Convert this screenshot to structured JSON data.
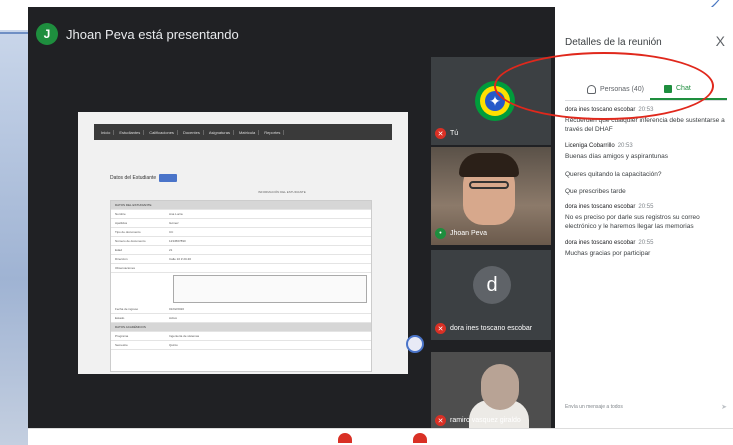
{
  "presenter": {
    "avatar_letter": "J",
    "text": "Jhoan Peva está presentando"
  },
  "shared_screen": {
    "nav": [
      "Inicio",
      "Estudiantes",
      "Calificaciones",
      "Docentes",
      "Asignaturas",
      "Matricula",
      "Reportes"
    ],
    "title": "Datos del Estudiante",
    "subtitle": "INFORMACIÓN DEL ESTUDIANTE",
    "rows": [
      {
        "a": "DATOS DEL ESTUDIANTE",
        "b": "",
        "head": true
      },
      {
        "a": "Nombre",
        "b": "Ana Lucía"
      },
      {
        "a": "Apellidos",
        "b": "Gómez"
      },
      {
        "a": "Tipo de documento",
        "b": "CC"
      },
      {
        "a": "Número de documento",
        "b": "1234567890"
      },
      {
        "a": "Edad",
        "b": "21"
      },
      {
        "a": "Dirección",
        "b": "Calle 10 # 20-30"
      },
      {
        "a": "Observaciones",
        "b": "",
        "box": true
      },
      {
        "a": "Fecha de ingreso",
        "b": "01/02/2020"
      },
      {
        "a": "Estado",
        "b": "Activo"
      },
      {
        "a": "DATOS ACADÉMICOS",
        "b": "",
        "head": true
      },
      {
        "a": "Programa",
        "b": "Ingeniería de sistemas"
      },
      {
        "a": "Semestre",
        "b": "Quinto"
      }
    ]
  },
  "tiles": [
    {
      "name": "Tú"
    },
    {
      "name": "Jhoan Peva"
    },
    {
      "name": "dora ines toscano escobar",
      "avatar_letter": "d"
    },
    {
      "name": "ramiro vasquez giraldo"
    }
  ],
  "panel": {
    "title": "Detalles de la reunión",
    "close": "X",
    "tab_people": "Personas (40)",
    "tab_chat": "Chat",
    "messages": [
      {
        "author": "dora ines toscano escobar",
        "time": "20:53",
        "text": "Recuerden que cualquier inferencia debe sustentarse a través del DHAF"
      },
      {
        "author": "Liceniga Cobarrillo",
        "time": "20:53",
        "text": "Buenas días amigos y aspirantunas",
        "extra": [
          "Queres quitando la capacitación?",
          "Que prescribes tarde"
        ]
      },
      {
        "author": "dora ines toscano escobar",
        "time": "20:55",
        "text": "No es preciso por darle sus registros su correo electrónico y le haremos llegar las memorias"
      },
      {
        "author": "dora ines toscano escobar",
        "time": "20:55",
        "text": "Muchas gracias por participar"
      }
    ],
    "compose_placeholder": "Envía un mensaje a todos",
    "send_icon": "send-icon"
  },
  "colors": {
    "meet_bg": "#202124",
    "accent_green": "#1e8e3e",
    "mic_off_red": "#d93025",
    "annotation_red": "#e0281c"
  }
}
